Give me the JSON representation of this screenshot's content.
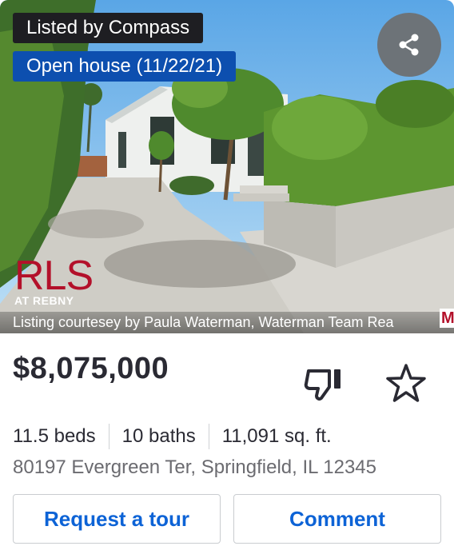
{
  "listing": {
    "brokerage_badge": "Listed by Compass",
    "open_house_badge": "Open house (11/22/21)",
    "logo_text": "RLS",
    "logo_subtext": "AT REBNY",
    "courtesy": "Listing courtesey by Paula Waterman, Waterman Team Rea",
    "corner_logo_text": "M",
    "share_icon": "share-icon",
    "price": "$8,075,000",
    "facts": {
      "beds": "11.5 beds",
      "baths": "10 baths",
      "sqft": "11,091 sq. ft."
    },
    "address": "80197 Evergreen Ter, Springfield, IL 12345"
  },
  "actions": {
    "dislike_icon": "thumbs-down-icon",
    "favorite_icon": "star-icon",
    "request_tour_label": "Request a tour",
    "comment_label": "Comment"
  },
  "colors": {
    "accent_blue": "#0d63d6",
    "open_house_bg": "#0d4faf",
    "brokerage_bg": "#1e1e22",
    "rls_red": "#b3102a"
  }
}
